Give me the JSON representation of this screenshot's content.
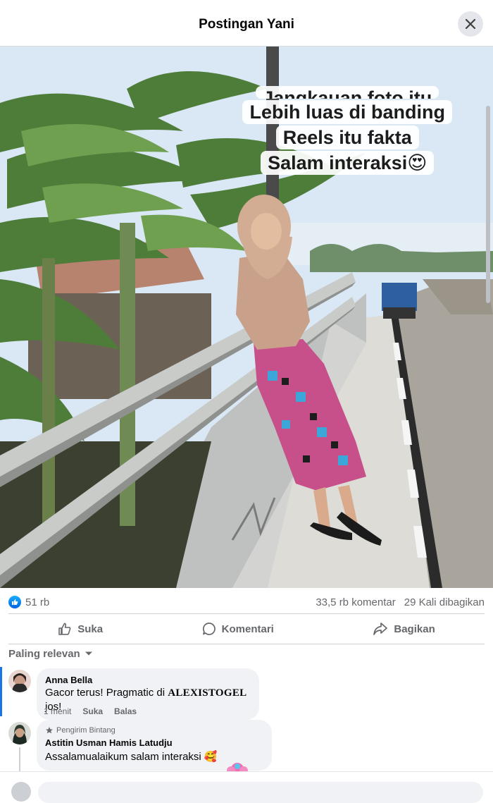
{
  "header": {
    "title": "Postingan Yani"
  },
  "photo": {
    "overlay_lines_partial": "Jangkauan foto itu",
    "overlay_lines": [
      "Lebih luas di banding",
      "Reels itu fakta",
      "Salam interaksi😍"
    ]
  },
  "stats": {
    "likes": "51 rb",
    "comments": "33,5 rb komentar",
    "shares": "29 Kali dibagikan"
  },
  "actions": {
    "like": "Suka",
    "comment": "Komentari",
    "share": "Bagikan"
  },
  "sort": {
    "label": "Paling relevan"
  },
  "comments": [
    {
      "name": "Anna Bella",
      "text_before": "Gacor terus! Pragmatic di ",
      "text_brand": "ALEXISTOGEL",
      "text_after": " jos!",
      "time": "1 menit",
      "like": "Suka",
      "reply": "Balas"
    },
    {
      "badge": "Pengirim Bintang",
      "name": "Astitin Usman Hamis Latudju",
      "text": "Assalamualaikum salam interaksi 🥰"
    }
  ],
  "colors": {
    "accent": "#1b74e4",
    "like_blue": "#0866ff",
    "bubble": "#f0f2f5",
    "secondary_text": "#65676b"
  }
}
